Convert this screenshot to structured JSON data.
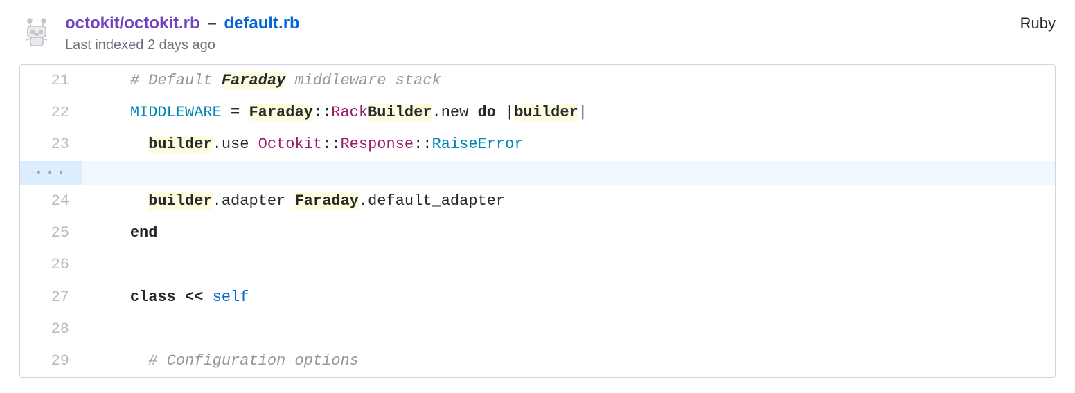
{
  "header": {
    "repo": "octokit/octokit.rb",
    "separator": " – ",
    "file": "default.rb",
    "language": "Ruby",
    "subtext": "Last indexed 2 days ago"
  },
  "ellipsis": "• • •",
  "lines": {
    "l21": {
      "num": "21",
      "t1": "    ",
      "t2": "# Default ",
      "t3": "Faraday",
      "t4": " middleware stack"
    },
    "l22": {
      "num": "22",
      "t1": "    ",
      "t2": "MIDDLEWARE",
      "t3": " ",
      "t4": "=",
      "t5": " ",
      "t6": "Faraday",
      "t7": "::",
      "t8": "Rack",
      "t9": "Builder",
      "t10": ".new ",
      "t11": "do",
      "t12": " |",
      "t13": "builder",
      "t14": "|"
    },
    "l23": {
      "num": "23",
      "t1": "      ",
      "t2": "builder",
      "t3": ".use ",
      "t4": "Octokit",
      "t5": "::",
      "t6": "Response",
      "t7": "::",
      "t8": "RaiseError"
    },
    "l24": {
      "num": "24",
      "t1": "      ",
      "t2": "builder",
      "t3": ".adapter ",
      "t4": "Faraday",
      "t5": ".default_adapter"
    },
    "l25": {
      "num": "25",
      "t1": "    ",
      "t2": "end"
    },
    "l26": {
      "num": "26",
      "t1": ""
    },
    "l27": {
      "num": "27",
      "t1": "    ",
      "t2": "class",
      "t3": " ",
      "t4": "<<",
      "t5": " ",
      "t6": "self"
    },
    "l28": {
      "num": "28",
      "t1": ""
    },
    "l29": {
      "num": "29",
      "t1": "      ",
      "t2": "# Configuration options"
    }
  }
}
